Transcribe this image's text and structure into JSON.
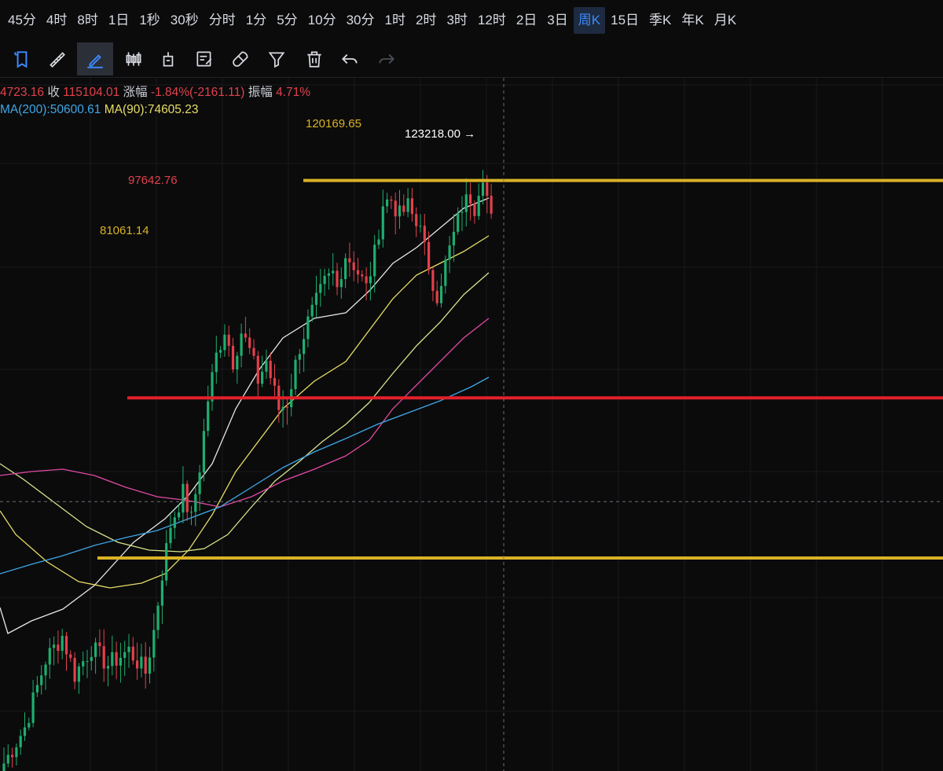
{
  "timeframes": [
    {
      "label": "45分"
    },
    {
      "label": "4时"
    },
    {
      "label": "8时"
    },
    {
      "label": "1日"
    },
    {
      "label": "1秒"
    },
    {
      "label": "30秒"
    },
    {
      "label": "分时"
    },
    {
      "label": "1分"
    },
    {
      "label": "5分"
    },
    {
      "label": "10分"
    },
    {
      "label": "30分"
    },
    {
      "label": "1时"
    },
    {
      "label": "2时"
    },
    {
      "label": "3时"
    },
    {
      "label": "12时"
    },
    {
      "label": "2日"
    },
    {
      "label": "3日"
    },
    {
      "label": "周K",
      "active": true
    },
    {
      "label": "15日"
    },
    {
      "label": "季K"
    },
    {
      "label": "年K"
    },
    {
      "label": "月K"
    }
  ],
  "tools": [
    {
      "icon": "selection-frame-icon"
    },
    {
      "icon": "ruler-icon"
    },
    {
      "icon": "pencil-draw-icon",
      "active": true
    },
    {
      "icon": "candlestick-icon"
    },
    {
      "icon": "indicator-icon"
    },
    {
      "icon": "note-edit-icon"
    },
    {
      "icon": "magnet-icon"
    },
    {
      "icon": "filter-icon"
    },
    {
      "icon": "trash-icon"
    },
    {
      "icon": "undo-icon"
    },
    {
      "icon": "redo-icon",
      "disabled": true
    }
  ],
  "info": {
    "low_value": "4723.16",
    "close_label": "收",
    "close_value": "115104.01",
    "change_label": "涨幅",
    "change_value": "-1.84%(-2161.11)",
    "amplitude_label": "振幅",
    "amplitude_value": "4.71%",
    "ma200_label": "MA(200):50600.61",
    "ma90_label": "MA(90):74605.23"
  },
  "colors": {
    "up": "#1eae6e",
    "down": "#e2414b",
    "level_yellow": "#d9b226",
    "level_red": "#e2202a",
    "ma_white": "#e6e6e6",
    "ma_yellow": "#e7de66",
    "ma_green": "#d5e58a",
    "ma_pink": "#e04aa3",
    "ma_blue": "#3ea7e6"
  },
  "chart_data": {
    "type": "candlestick",
    "ylim": [
      59000,
      130800
    ],
    "levels": [
      {
        "name": "resistance-upper",
        "value": 120169.65,
        "label": "120169.65",
        "color": "yellow"
      },
      {
        "name": "resistance-mid",
        "value": 97642.76,
        "label": "97642.76",
        "color": "red"
      },
      {
        "name": "support",
        "value": 81061.14,
        "label": "81061.14",
        "color": "yellow"
      }
    ],
    "high_marker": {
      "value": 123218.0,
      "label": "123218.00 →"
    },
    "crosshair": {
      "price": 86900
    }
  }
}
